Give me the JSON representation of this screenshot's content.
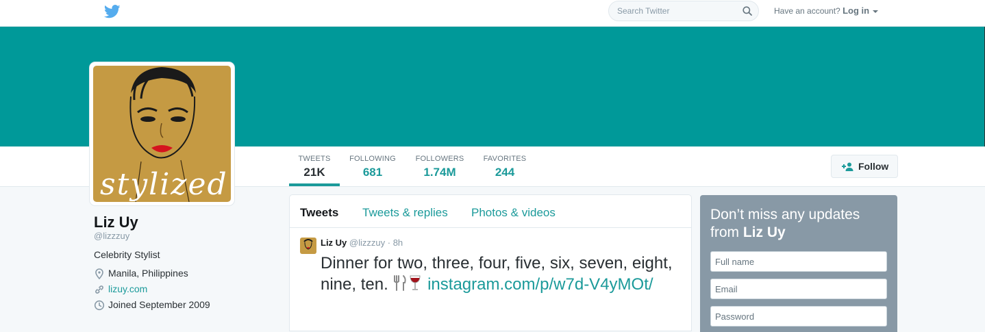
{
  "topbar": {
    "search_placeholder": "Search Twitter",
    "account_prompt": "Have an account?",
    "login_label": "Log in"
  },
  "colors": {
    "accent": "#1b9a9a",
    "banner": "#009999",
    "avatar_bg": "#c59a43",
    "signup_bg": "#8899a6"
  },
  "stats": [
    {
      "label": "TWEETS",
      "value": "21K"
    },
    {
      "label": "FOLLOWING",
      "value": "681"
    },
    {
      "label": "FOLLOWERS",
      "value": "1.74M"
    },
    {
      "label": "FAVORITES",
      "value": "244"
    }
  ],
  "follow_label": "Follow",
  "avatar_text": "stylized",
  "profile": {
    "name": "Liz Uy",
    "handle": "@lizzzuy",
    "bio": "Celebrity Stylist",
    "location": "Manila, Philippines",
    "website": "lizuy.com",
    "joined": "Joined September 2009"
  },
  "timeline": {
    "tabs": [
      "Tweets",
      "Tweets & replies",
      "Photos & videos"
    ],
    "tweet": {
      "name": "Liz Uy",
      "handle": "@lizzzuy",
      "time": "· 8h",
      "text": "Dinner for two, three, four, five, six, seven, eight, nine, ten.",
      "emojis": [
        "fork-knife-icon",
        "wine-glass-icon"
      ],
      "link": "instagram.com/p/w7d-V4yMOt/"
    }
  },
  "signup": {
    "heading_prefix": "Don’t miss any updates from",
    "heading_name": "Liz Uy",
    "fields": [
      "Full name",
      "Email",
      "Password"
    ]
  }
}
